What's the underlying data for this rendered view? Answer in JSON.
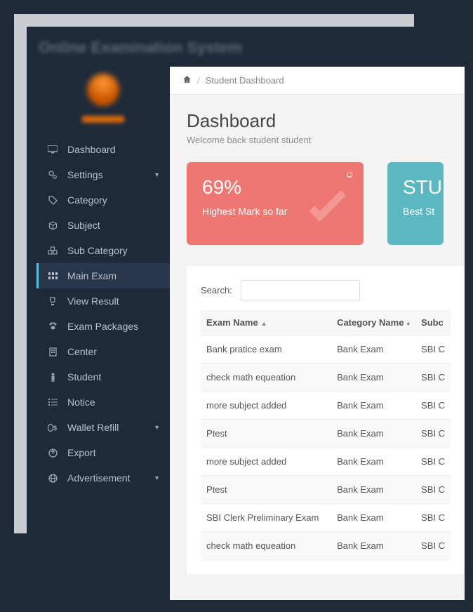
{
  "app_title": "Online Examination System",
  "breadcrumb": "Student Dashboard",
  "dashboard": {
    "title": "Dashboard",
    "subtitle": "Welcome back student student"
  },
  "sidebar": {
    "items": [
      {
        "label": "Dashboard"
      },
      {
        "label": "Settings"
      },
      {
        "label": "Category"
      },
      {
        "label": "Subject"
      },
      {
        "label": "Sub Category"
      },
      {
        "label": "Main Exam"
      },
      {
        "label": "View Result"
      },
      {
        "label": "Exam Packages"
      },
      {
        "label": "Center"
      },
      {
        "label": "Student"
      },
      {
        "label": "Notice"
      },
      {
        "label": "Wallet Refill"
      },
      {
        "label": "Export"
      },
      {
        "label": "Advertisement"
      }
    ]
  },
  "cards": {
    "red": {
      "value": "69%",
      "label": "Highest Mark so far"
    },
    "teal": {
      "value": "STU",
      "label": "Best St"
    }
  },
  "search_label": "Search:",
  "table": {
    "columns": [
      "Exam Name",
      "Category Name",
      "Subc"
    ],
    "rows": [
      {
        "exam": "Bank pratice exam",
        "category": "Bank Exam",
        "sub": "SBI C"
      },
      {
        "exam": "check math equeation",
        "category": "Bank Exam",
        "sub": "SBI C"
      },
      {
        "exam": "more subject added",
        "category": "Bank Exam",
        "sub": "SBI C"
      },
      {
        "exam": "Ptest",
        "category": "Bank Exam",
        "sub": "SBI C"
      },
      {
        "exam": "more subject added",
        "category": "Bank Exam",
        "sub": "SBI C"
      },
      {
        "exam": "Ptest",
        "category": "Bank Exam",
        "sub": "SBI C"
      },
      {
        "exam": "SBI Clerk Preliminary Exam",
        "category": "Bank Exam",
        "sub": "SBI C"
      },
      {
        "exam": "check math equeation",
        "category": "Bank Exam",
        "sub": "SBI C"
      }
    ]
  }
}
